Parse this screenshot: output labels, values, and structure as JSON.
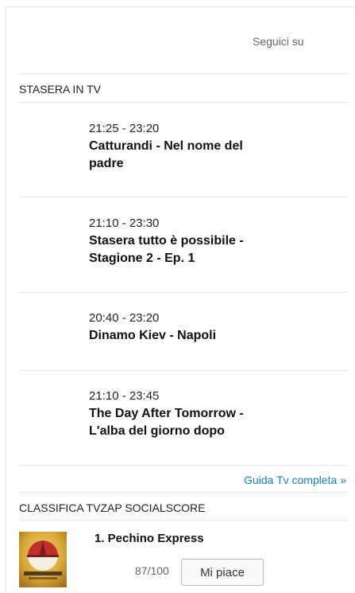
{
  "header": {
    "follow_label": "Seguici su"
  },
  "tonight": {
    "title": "STASERA IN TV",
    "programs": [
      {
        "time": "21:25 - 23:20",
        "title": "Catturandi - Nel nome del padre"
      },
      {
        "time": "21:10 - 23:30",
        "title": "Stasera tutto è possibile - Stagione 2 - Ep. 1"
      },
      {
        "time": "20:40 - 23:20",
        "title": "Dinamo Kiev - Napoli"
      },
      {
        "time": "21:10 - 23:45",
        "title": "The Day After Tomorrow - L'alba del giorno dopo"
      }
    ],
    "guide_link": "Guida Tv completa »"
  },
  "ranking": {
    "title": "CLASSIFICA TVZAP SOCIALSCORE",
    "items": [
      {
        "rank_title": "1. Pechino Express",
        "score": "87/100",
        "like_label": "Mi piace"
      }
    ]
  },
  "colors": {
    "link": "#1a7ec4",
    "rule": "#e3e3e3"
  }
}
